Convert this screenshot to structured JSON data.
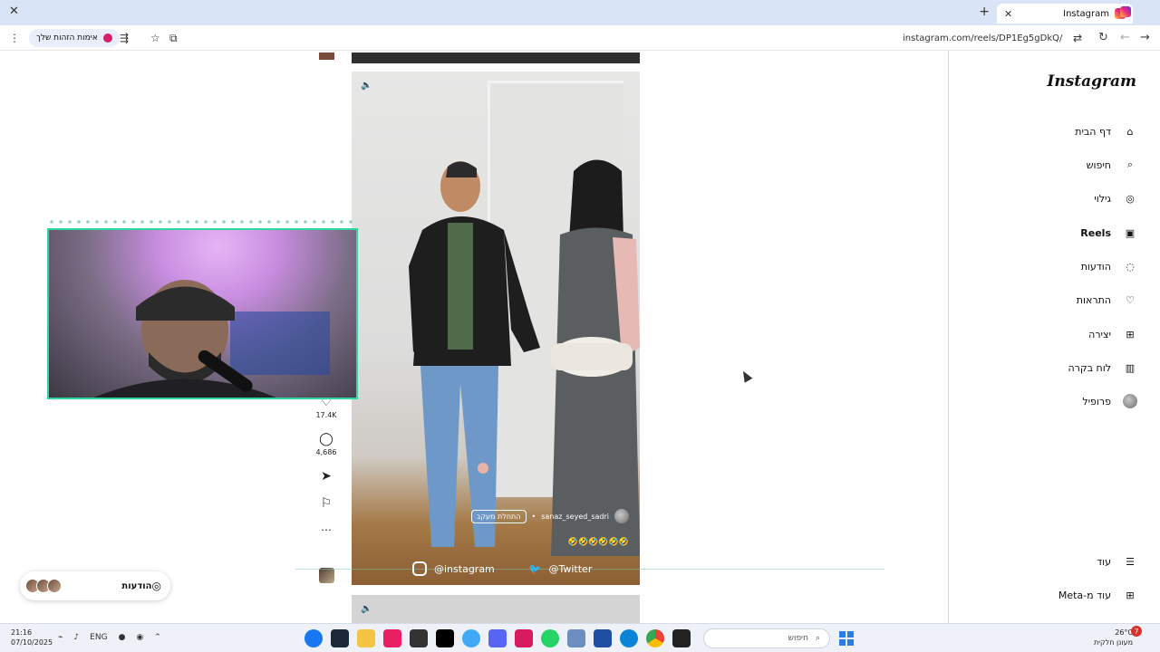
{
  "browser": {
    "tab_title": "Instagram",
    "url": "instagram.com/reels/DP1Eg5gDkQ/",
    "identity_label": "אימות הזהות שלך"
  },
  "sidebar": {
    "logo": "Instagram",
    "items": [
      {
        "label": "דף הבית",
        "icon": "home-icon"
      },
      {
        "label": "חיפוש",
        "icon": "search-icon"
      },
      {
        "label": "גילוי",
        "icon": "compass-icon"
      },
      {
        "label": "Reels",
        "icon": "reels-icon"
      },
      {
        "label": "הודעות",
        "icon": "messenger-icon"
      },
      {
        "label": "התראות",
        "icon": "heart-icon"
      },
      {
        "label": "יצירה",
        "icon": "plus-square-icon"
      },
      {
        "label": "לוח בקרה",
        "icon": "dashboard-icon"
      },
      {
        "label": "פרופיל",
        "icon": "avatar-icon"
      }
    ],
    "bottom": [
      {
        "label": "עוד",
        "icon": "menu-icon"
      },
      {
        "label": "עוד מ-Meta",
        "icon": "grid-icon"
      }
    ]
  },
  "reel": {
    "username": "sanaz_seyed_sadri",
    "follow_label": "התחלת מעקב",
    "caption_emojis": "🤣🤣🤣🤣🤣🤣",
    "likes": "17.4K",
    "comments": "4,686"
  },
  "overlay": {
    "instagram_handle": "@instagram",
    "twitter_handle": "@Twitter"
  },
  "messages_pill": {
    "label": "הודעות"
  },
  "taskbar": {
    "time": "21:16",
    "date": "07/10/2025",
    "lang": "ENG",
    "search_placeholder": "חיפוש",
    "weather_temp": "26°C",
    "weather_desc": "מעונן חלקית",
    "notification_count": "7"
  }
}
